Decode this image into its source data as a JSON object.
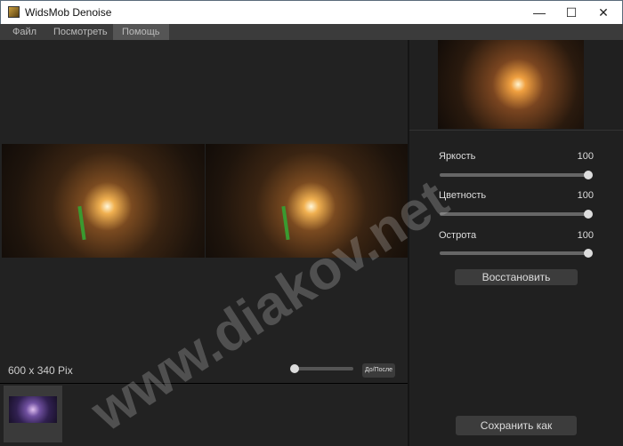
{
  "window": {
    "title": "WidsMob Denoise",
    "minimize": "—",
    "maximize": "☐",
    "close": "✕"
  },
  "menu": [
    {
      "label": "Файл"
    },
    {
      "label": "Посмотреть"
    },
    {
      "label": "Помощь"
    }
  ],
  "status": {
    "resolution": "600 x 340 Pix",
    "zoom_fraction": 0,
    "before_after": "До/После"
  },
  "adjustments": [
    {
      "label": "Яркость",
      "value": "100",
      "fraction": 1
    },
    {
      "label": "Цветность",
      "value": "100",
      "fraction": 1
    },
    {
      "label": "Острота",
      "value": "100",
      "fraction": 1
    }
  ],
  "buttons": {
    "reset": "Восстановить",
    "save_as": "Сохранить как"
  },
  "watermark": "www.diakov.net"
}
